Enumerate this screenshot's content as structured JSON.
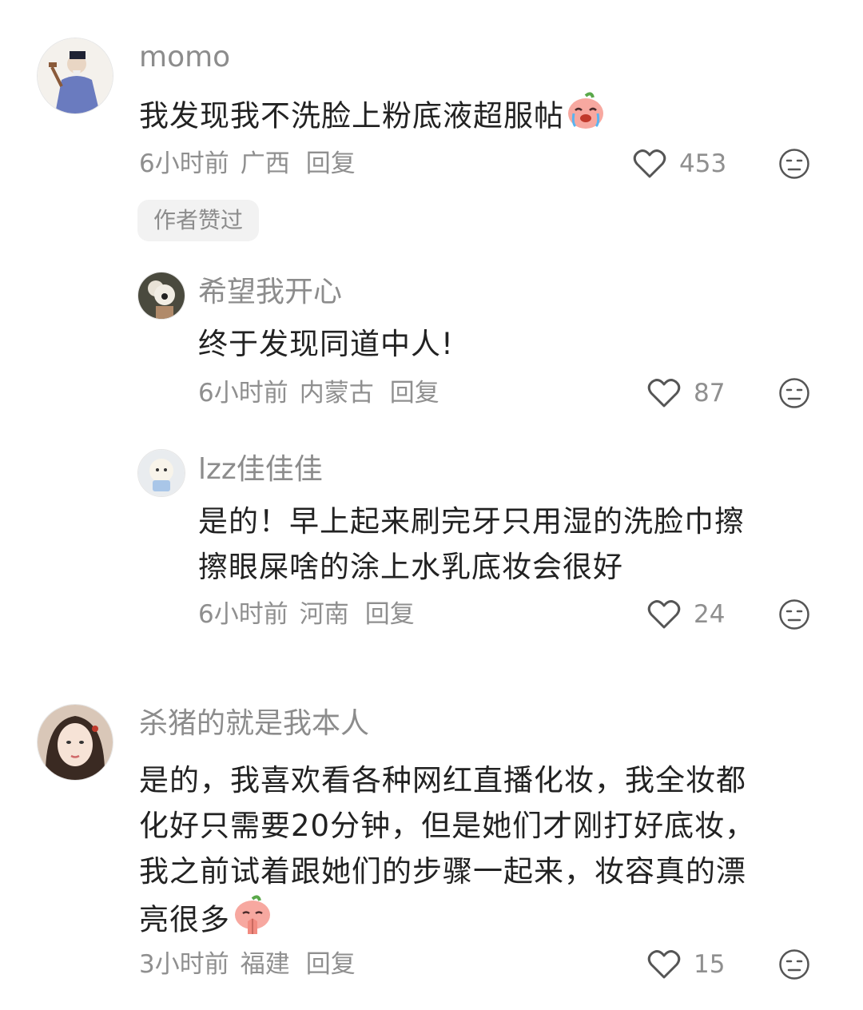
{
  "comments": [
    {
      "username": "momo",
      "text": "我发现我不洗脸上粉底液超服帖",
      "emoji": "crying-peach-emoji",
      "time": "6小时前",
      "location": "广西",
      "reply_label": "回复",
      "likes": "453",
      "badge": "作者赞过",
      "replies": [
        {
          "username": "希望我开心",
          "text": "终于发现同道中人!",
          "time": "6小时前",
          "location": "内蒙古",
          "reply_label": "回复",
          "likes": "87"
        },
        {
          "username": "lzz佳佳佳",
          "text_line1": "是的！早上起来刷完牙只用湿的洗脸巾擦",
          "text_line2": "擦眼屎啥的涂上水乳底妆会很好",
          "time": "6小时前",
          "location": "河南",
          "reply_label": "回复",
          "likes": "24"
        }
      ]
    },
    {
      "username": "杀猪的就是我本人",
      "text_line1": "是的，我喜欢看各种网红直播化妆，我全妆都",
      "text_line2": "化好只需要20分钟，但是她们才刚打好底妆，",
      "text_line3": "我之前试着跟她们的步骤一起来，妆容真的漂",
      "text_line4": "亮很多",
      "emoji": "praying-peach-emoji",
      "time": "3小时前",
      "location": "福建",
      "reply_label": "回复",
      "likes": "15"
    }
  ],
  "colors": {
    "text": "#222222",
    "muted": "#8c8c8c",
    "badge_bg": "#f2f2f2",
    "peach": "#f7a8a0"
  }
}
